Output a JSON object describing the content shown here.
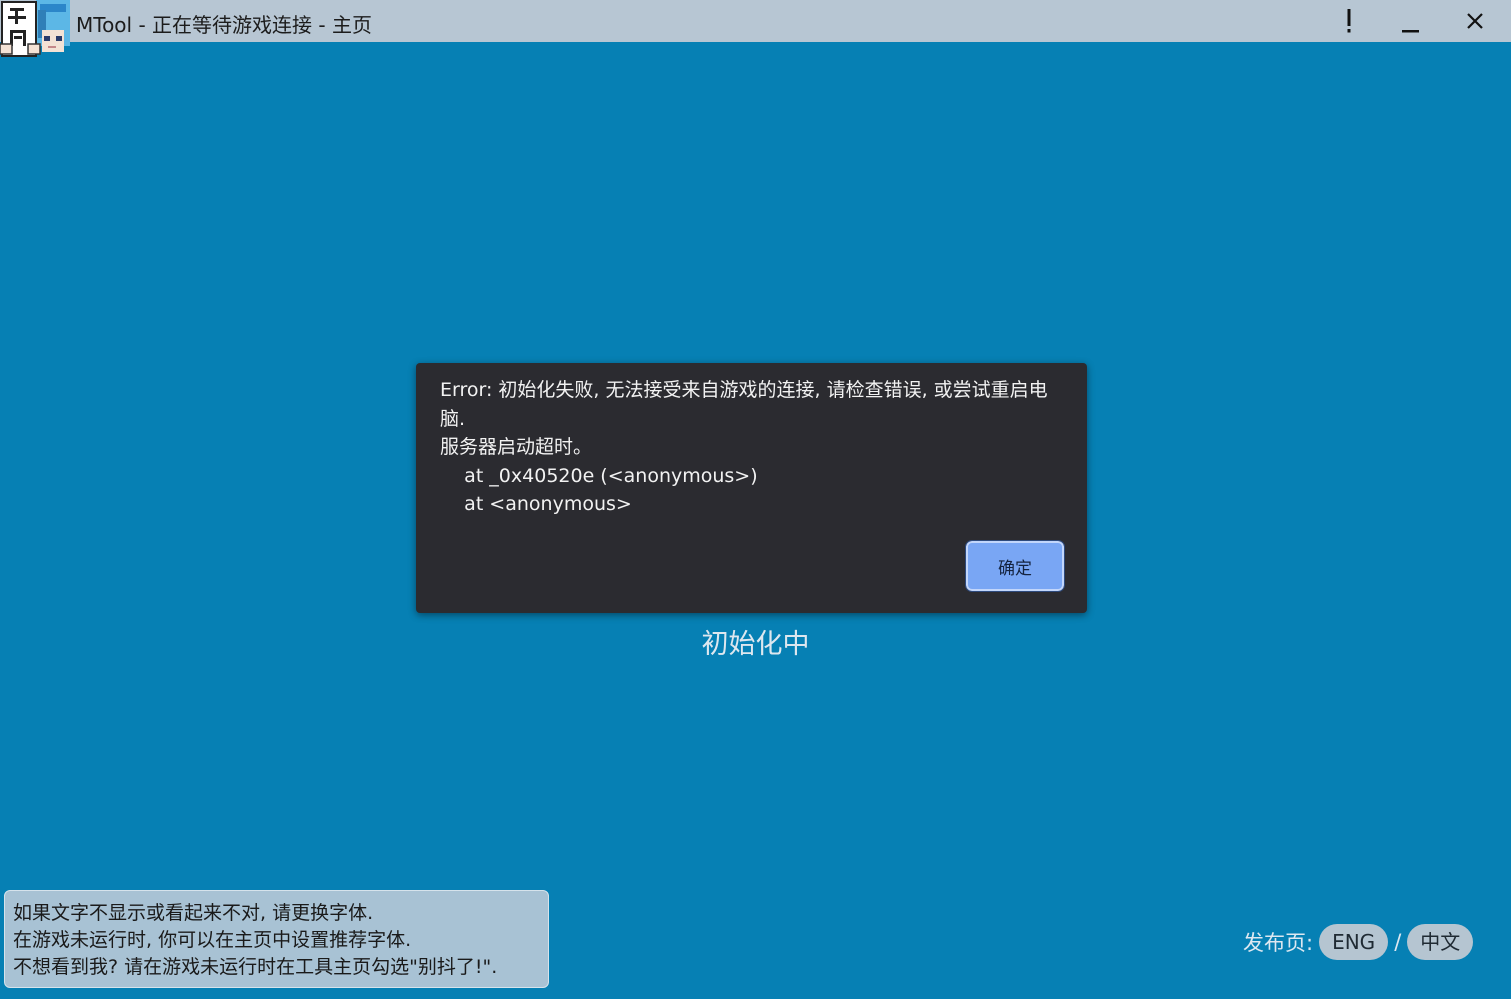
{
  "window": {
    "title": "MTool - 正在等待游戏连接 - 主页",
    "app_icon": "mtool-pixel-avatar-icon",
    "alert_icon": "exclamation-icon",
    "minimize_icon": "minimize-icon",
    "close_icon": "close-icon"
  },
  "dialog": {
    "message": "Error: 初始化失败, 无法接受来自游戏的连接, 请检查错误, 或尝试重启电脑.\n服务器启动超时。\n    at _0x40520e (<anonymous>)\n    at <anonymous>",
    "ok_label": "确定"
  },
  "status": {
    "text": "初始化中"
  },
  "font_notice": {
    "lines": [
      "如果文字不显示或看起来不对, 请更换字体.",
      "在游戏未运行时, 你可以在主页中设置推荐字体.",
      "不想看到我? 请在游戏未运行时在工具主页勾选\"别抖了!\"."
    ]
  },
  "release": {
    "label": "发布页:",
    "eng": "ENG",
    "separator": "/",
    "zh": "中文"
  },
  "colors": {
    "background": "#0680b4",
    "titlebar": "#b7c6d3",
    "dialog": "#2b2b30",
    "ok_button": "#79a6f4"
  }
}
